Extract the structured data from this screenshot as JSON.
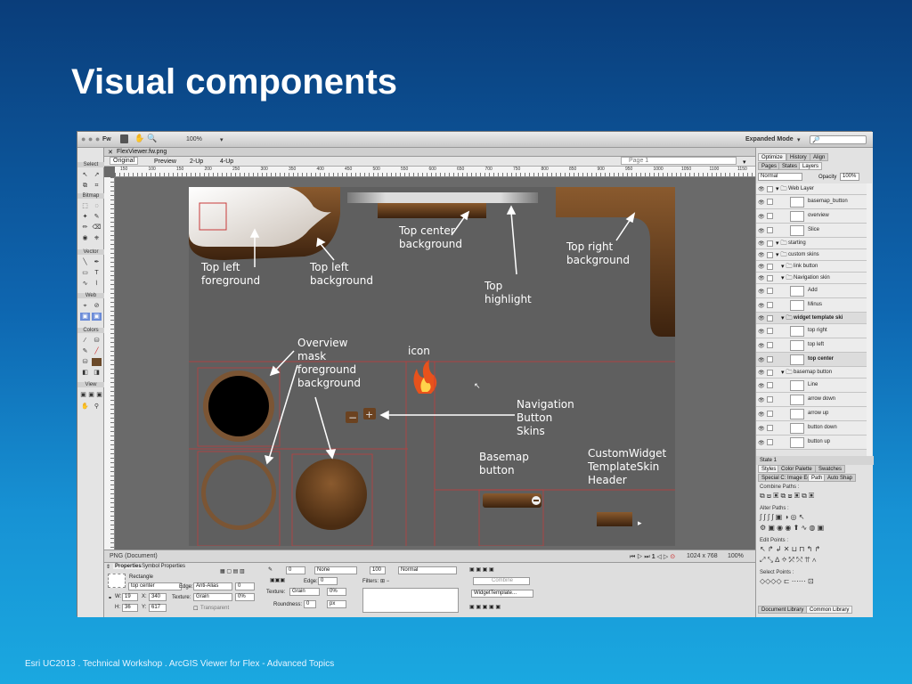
{
  "slide": {
    "title": "Visual components",
    "footer": "Esri UC2013 . Technical Workshop . ArcGIS Viewer for Flex - Advanced Topics"
  },
  "app": {
    "logo": "Fw",
    "zoom": "100%",
    "workspace": "Expanded Mode",
    "search_placeholder": "🔎",
    "toolbox": {
      "sections": [
        "Select",
        "Bitmap",
        "Vector",
        "Web",
        "Colors",
        "View"
      ]
    },
    "document": {
      "tab": "FlexViewer.fw.png",
      "views": [
        "Original",
        "Preview",
        "2-Up",
        "4-Up"
      ],
      "page": "Page 1",
      "ruler": [
        "150",
        "100",
        "150",
        "200",
        "250",
        "300",
        "350",
        "400",
        "450",
        "500",
        "550",
        "600",
        "650",
        "700",
        "750",
        "800",
        "850",
        "900",
        "950",
        "1000",
        "1050",
        "1100",
        "1150"
      ],
      "status_left": "PNG (Document)",
      "frame": "1",
      "dimensions": "1024 x 768",
      "zoom": "100%"
    },
    "annotations": {
      "top_left_foreground": "Top left\nforeground",
      "top_left_background": "Top left\nbackground",
      "top_center_background": "Top center\nbackground",
      "top_highlight": "Top\nhighlight",
      "top_right_background": "Top right\nbackground",
      "overview_mask": "Overview\nmask\nforeground\nbackground",
      "icon": "icon",
      "navigation_button_skins": "Navigation\nButton\nSkins",
      "basemap_button": "Basemap\nbutton",
      "customwidget_header": "CustomWidget\nTemplateSkin\nHeader"
    },
    "properties": {
      "tabs": [
        "Properties",
        "Symbol Properties"
      ],
      "object_type": "Rectangle",
      "object_name": "top center",
      "edge_label": "Edge:",
      "edge_value": "Anti-Alias",
      "edge_num": "0",
      "texture_label": "Texture:",
      "texture_value": "Grain",
      "texture_pct": "0%",
      "transparent": "Transparent",
      "w": "19",
      "x": "340",
      "h": "36",
      "y": "617",
      "stroke_num": "0",
      "stroke_type": "None",
      "edge2": "0",
      "texture2": "Grain",
      "texture2_pct": "0%",
      "roundness_label": "Roundness:",
      "roundness": "0",
      "roundness_unit": "px",
      "opacity": "100",
      "blend": "Normal",
      "filters_label": "Filters:",
      "combine": "Combine",
      "widget_template": "WidgetTemplate..."
    },
    "layers_panel": {
      "tabs_top": [
        "Optimize",
        "History",
        "Align"
      ],
      "tabs_mid": [
        "Pages",
        "States",
        "Layers"
      ],
      "blend": "Normal",
      "opacity_label": "Opacity",
      "opacity": "100%",
      "rows": [
        {
          "name": "Web Layer",
          "folder": true,
          "bold": false
        },
        {
          "name": "basemap_button",
          "folder": false
        },
        {
          "name": "overview",
          "folder": false
        },
        {
          "name": "Slice",
          "folder": false
        },
        {
          "name": "starting",
          "folder": true
        },
        {
          "name": "custom skins",
          "folder": true
        },
        {
          "name": "link button",
          "folder": true
        },
        {
          "name": "Navigation skin",
          "folder": true
        },
        {
          "name": "Add",
          "folder": false
        },
        {
          "name": "Minus",
          "folder": false
        },
        {
          "name": "widget template ski",
          "folder": true,
          "bold": true
        },
        {
          "name": "top right",
          "folder": false
        },
        {
          "name": "top left",
          "folder": false
        },
        {
          "name": "top center",
          "folder": false,
          "bold": true
        },
        {
          "name": "basemap button",
          "folder": true
        },
        {
          "name": "Line",
          "folder": false
        },
        {
          "name": "arrow down",
          "folder": false
        },
        {
          "name": "arrow up",
          "folder": false
        },
        {
          "name": "button down",
          "folder": false
        },
        {
          "name": "button up",
          "folder": false
        }
      ],
      "state": "State 1",
      "tabs_bottom": [
        "Styles",
        "Color Palette",
        "Swatches"
      ],
      "tabs_path": [
        "Special C: Image Ed",
        "Path",
        "Auto Shap"
      ],
      "combine_paths": "Combine Paths :",
      "alter_paths": "Alter Paths :",
      "edit_points": "Edit Points :",
      "select_points": "Select Points :",
      "library_tabs": [
        "Document Library",
        "Common Library"
      ]
    }
  }
}
